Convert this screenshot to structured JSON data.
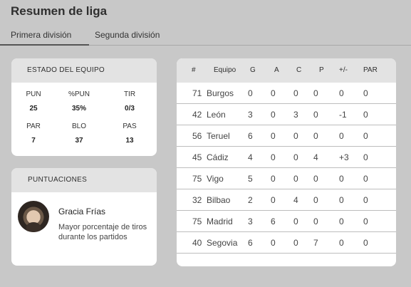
{
  "app": {
    "title": "Resumen de liga"
  },
  "tabs": [
    {
      "label": "Primera división",
      "active": true
    },
    {
      "label": "Segunda división",
      "active": false
    }
  ],
  "team_stats": {
    "title": "ESTADO DEL EQUIPO",
    "items": [
      {
        "label": "PUN",
        "value": "25"
      },
      {
        "label": "%PUN",
        "value": "35%"
      },
      {
        "label": "TIR",
        "value": "0/3"
      },
      {
        "label": "PAR",
        "value": "7"
      },
      {
        "label": "BLO",
        "value": "37"
      },
      {
        "label": "PAS",
        "value": "13"
      }
    ]
  },
  "scores": {
    "title": "PUNTUACIONES",
    "player_name": "Gracia Frías",
    "description": "Mayor porcentaje de tiros durante los partidos"
  },
  "table": {
    "headers": [
      "#",
      "Equipo",
      "G",
      "A",
      "C",
      "P",
      "+/-",
      "PAR"
    ],
    "rows": [
      [
        "71",
        "Burgos",
        "0",
        "0",
        "0",
        "0",
        "0",
        "0"
      ],
      [
        "42",
        "León",
        "3",
        "0",
        "3",
        "0",
        "-1",
        "0"
      ],
      [
        "56",
        "Teruel",
        "6",
        "0",
        "0",
        "0",
        "0",
        "0"
      ],
      [
        "45",
        "Cádiz",
        "4",
        "0",
        "0",
        "4",
        "+3",
        "0"
      ],
      [
        "75",
        "Vigo",
        "5",
        "0",
        "0",
        "0",
        "0",
        "0"
      ],
      [
        "32",
        "Bilbao",
        "2",
        "0",
        "4",
        "0",
        "0",
        "0"
      ],
      [
        "75",
        "Madrid",
        "3",
        "6",
        "0",
        "0",
        "0",
        "0"
      ],
      [
        "40",
        "Segovia",
        "6",
        "0",
        "0",
        "7",
        "0",
        "0"
      ]
    ]
  },
  "colors": {
    "background": "#c8c8c8",
    "card": "#ffffff",
    "card_header": "#e3e3e3",
    "active_tab_underline": "#555555"
  }
}
